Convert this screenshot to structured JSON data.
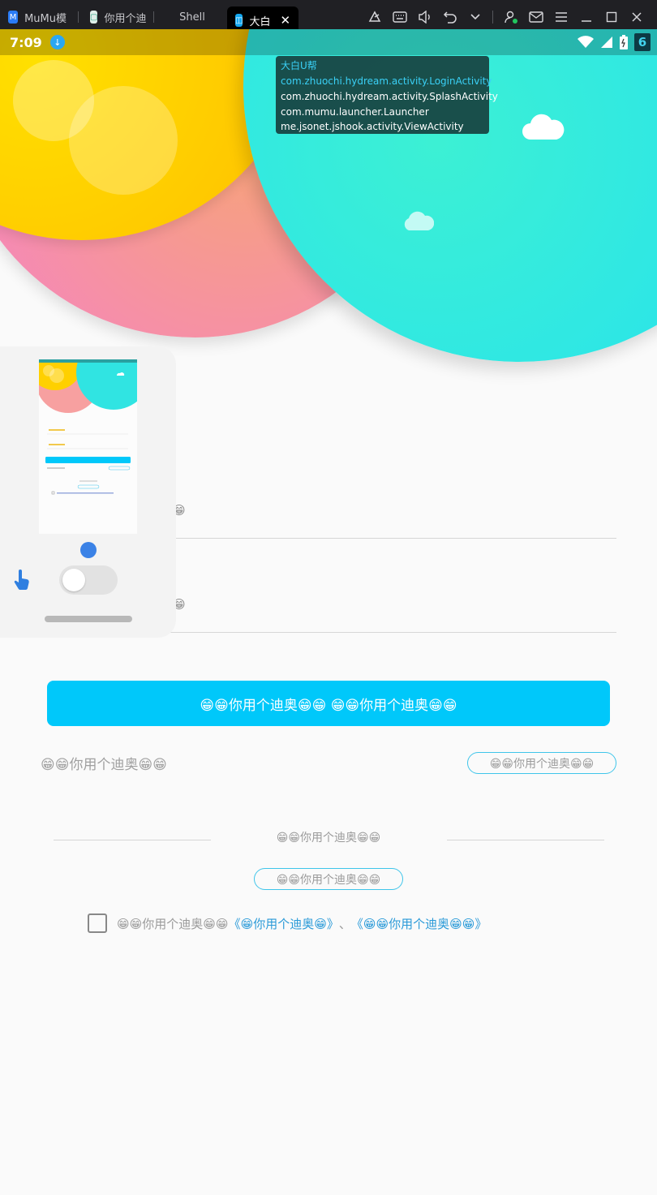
{
  "titlebar": {
    "tabs": [
      {
        "label": "MuMu模",
        "icon": "mumu-logo-icon",
        "icon_color": "#2a7cf6"
      },
      {
        "label": "你用个迪",
        "icon": "app-thumbnail-icon",
        "icon_color": "#dfeee8"
      },
      {
        "label": "Shell",
        "icon": "",
        "icon_color": ""
      },
      {
        "label": "大白",
        "icon": "dabai-app-icon",
        "icon_color": "#12a7f0"
      }
    ],
    "controls": [
      "broadcast-icon",
      "keyboard-icon",
      "volume-icon",
      "undo-icon",
      "chevron-down-icon",
      "account-icon",
      "mail-icon",
      "menu-icon",
      "minimize-icon",
      "maximize-icon",
      "close-icon"
    ]
  },
  "statusbar": {
    "time": "7:09",
    "badge": "6"
  },
  "activities": {
    "app_name": "大白U帮",
    "items": [
      "com.zhuochi.hydream.activity.LoginActivity",
      "com.zhuochi.hydream.activity.SplashActivity",
      "com.mumu.launcher.Launcher",
      "me.jsonet.jshook.activity.ViewActivity"
    ]
  },
  "form": {
    "account_hint": ":😁",
    "password_hint": ":😁",
    "login_label": "😁😁你用个迪奥😁😁 😁😁你用个迪奥😁😁",
    "left_link": "😁😁你用个迪奥😁😁",
    "right_pill": "😁😁你用个迪奥😁😁",
    "divider_text": "😁😁你用个迪奥😁😁",
    "center_pill": "😁😁你用个迪奥😁😁",
    "agree_prefix": "😁😁你用个迪奥😁😁",
    "agree_link1": "《😁你用个迪奥😁》",
    "agree_sep": "、",
    "agree_link2": "《😁😁你用个迪奥😁😁》"
  },
  "colors": {
    "primary": "#00c8fa",
    "teal": "#2de6e0",
    "yellow": "#ffd400",
    "pink": "#f48fb8"
  }
}
